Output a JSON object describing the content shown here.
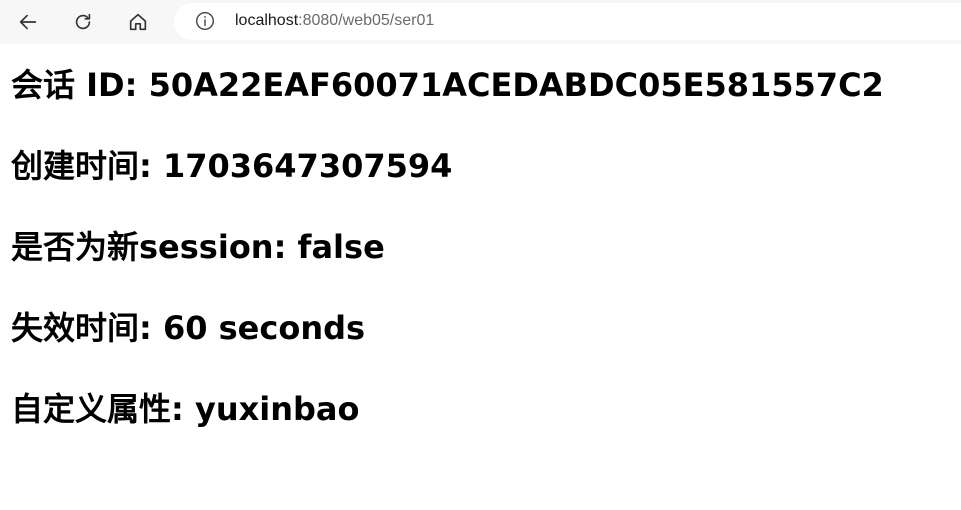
{
  "browser": {
    "url_host": "localhost",
    "url_rest": ":8080/web05/ser01"
  },
  "page": {
    "lines": [
      {
        "label": "会话 ID: ",
        "value": "50A22EAF60071ACEDABDC05E581557C2"
      },
      {
        "label": "创建时间: ",
        "value": "1703647307594"
      },
      {
        "label": "是否为新session: ",
        "value": "false"
      },
      {
        "label": "失效时间: ",
        "value": "60 seconds"
      },
      {
        "label": "自定义属性: ",
        "value": "yuxinbao"
      }
    ]
  }
}
